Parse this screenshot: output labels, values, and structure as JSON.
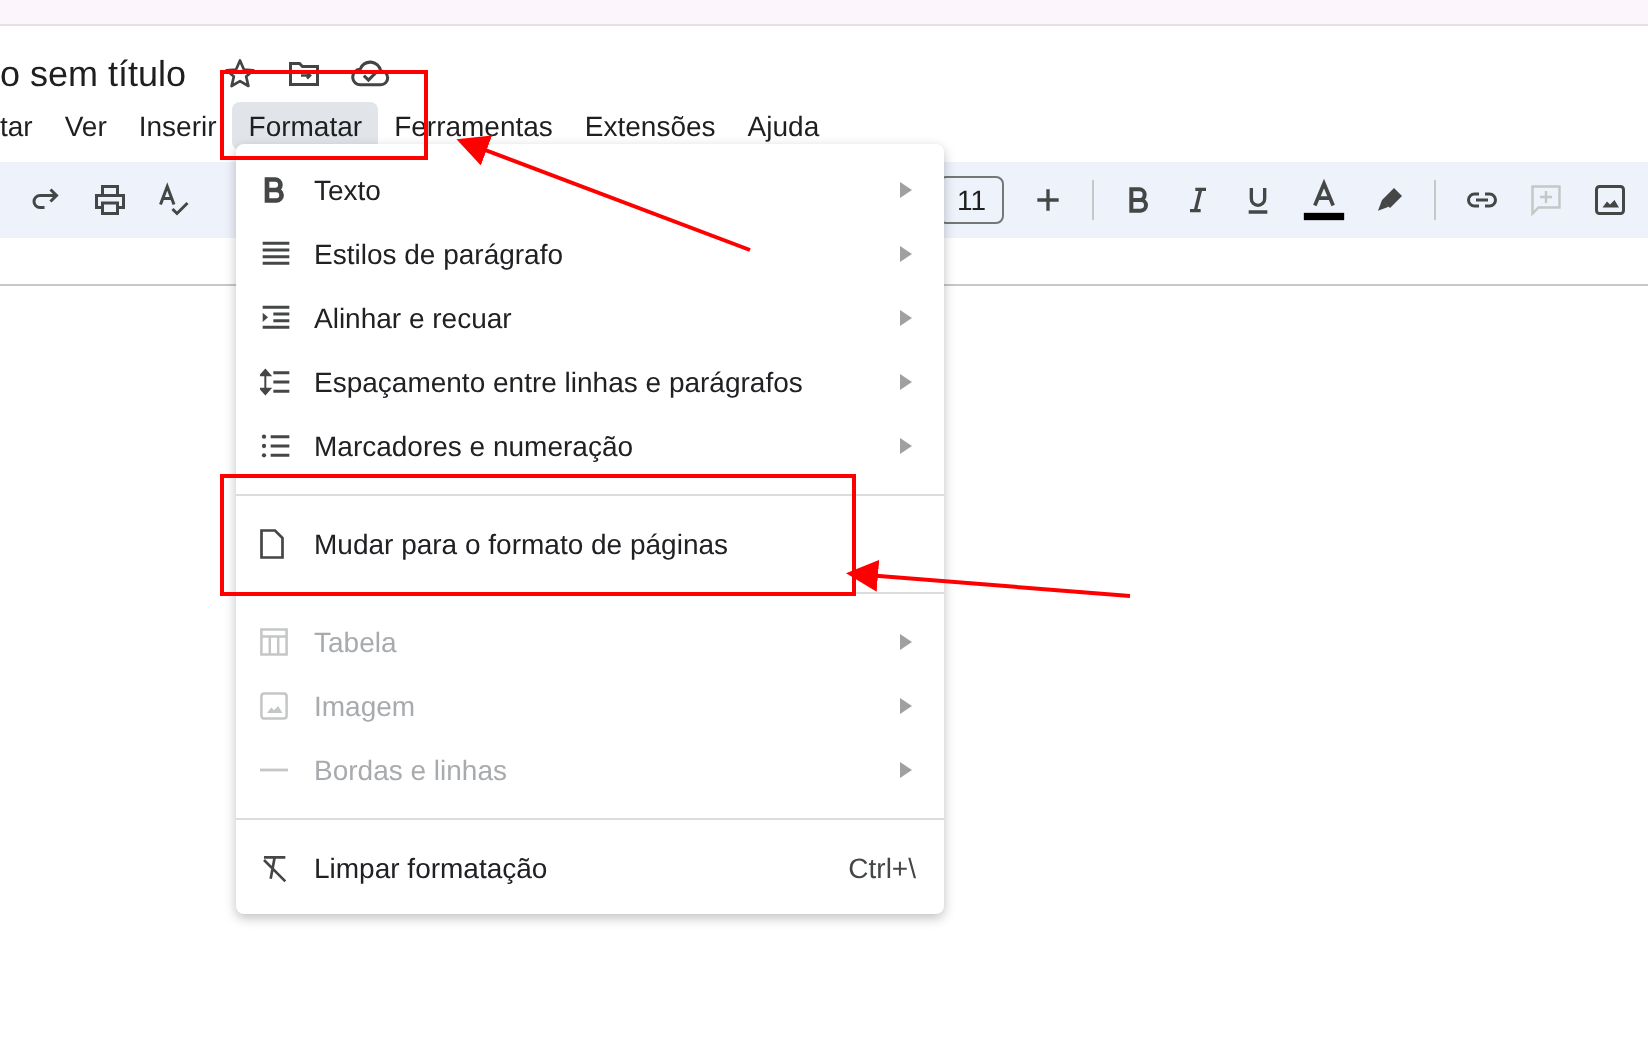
{
  "document": {
    "title": "o sem título"
  },
  "menubar": [
    {
      "label": "tar",
      "selected": false
    },
    {
      "label": "Ver",
      "selected": false
    },
    {
      "label": "Inserir",
      "selected": false
    },
    {
      "label": "Formatar",
      "selected": true
    },
    {
      "label": "Ferramentas",
      "selected": false
    },
    {
      "label": "Extensões",
      "selected": false
    },
    {
      "label": "Ajuda",
      "selected": false
    }
  ],
  "toolbar": {
    "left": [
      {
        "kind": "redo",
        "disabled": false
      },
      {
        "kind": "print",
        "disabled": false
      },
      {
        "kind": "spellcheck",
        "disabled": false
      }
    ],
    "font_size": "11",
    "right": [
      {
        "kind": "plus",
        "disabled": false
      },
      {
        "kind": "sep"
      },
      {
        "kind": "bold",
        "disabled": false
      },
      {
        "kind": "italic",
        "disabled": false
      },
      {
        "kind": "underline",
        "disabled": false
      },
      {
        "kind": "textcolor",
        "disabled": false
      },
      {
        "kind": "highlight",
        "disabled": false
      },
      {
        "kind": "sep"
      },
      {
        "kind": "link",
        "disabled": false
      },
      {
        "kind": "comment",
        "disabled": true
      },
      {
        "kind": "image",
        "disabled": false
      }
    ]
  },
  "format_menu": [
    {
      "kind": "item",
      "label": "Texto",
      "submenu": true,
      "disabled": false
    },
    {
      "kind": "item",
      "label": "Estilos de parágrafo",
      "submenu": true,
      "disabled": false
    },
    {
      "kind": "item",
      "label": "Alinhar e recuar",
      "submenu": true,
      "disabled": false
    },
    {
      "kind": "item",
      "label": "Espaçamento entre linhas e parágrafos",
      "submenu": true,
      "disabled": false
    },
    {
      "kind": "item",
      "label": "Marcadores e numeração",
      "submenu": true,
      "disabled": false
    },
    {
      "kind": "divider"
    },
    {
      "kind": "item",
      "label": "Mudar para o formato de páginas",
      "submenu": false,
      "disabled": false
    },
    {
      "kind": "divider"
    },
    {
      "kind": "item",
      "label": "Tabela",
      "submenu": true,
      "disabled": true
    },
    {
      "kind": "item",
      "label": "Imagem",
      "submenu": true,
      "disabled": true
    },
    {
      "kind": "item",
      "label": "Bordas e linhas",
      "submenu": true,
      "disabled": true
    },
    {
      "kind": "divider"
    },
    {
      "kind": "item",
      "label": "Limpar formatação",
      "submenu": false,
      "disabled": false,
      "shortcut": "Ctrl+\\"
    }
  ]
}
